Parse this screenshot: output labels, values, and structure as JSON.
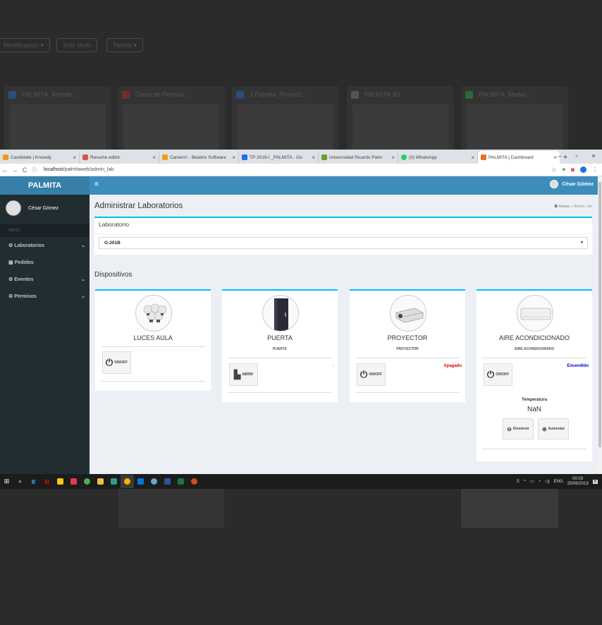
{
  "background": {
    "buttons": [
      "Modificación ▾",
      "Solo título",
      "Tareas ▾"
    ],
    "cards": [
      "PALMITA_Arquite...",
      "Clase de Permisi...",
      "3.Palmita_Proyect...",
      "PALMITA 3D",
      "PALMITA_Model..."
    ]
  },
  "browser": {
    "tabs": [
      {
        "title": "Candidate | Knowdy",
        "color": "#f09a1a"
      },
      {
        "title": "Resume editor",
        "color": "#d9534f"
      },
      {
        "title": "Careers! - Belatrix Software",
        "color": "#f0a010"
      },
      {
        "title": "TP 2019-I _PALMITA - Go",
        "color": "#1a73e8"
      },
      {
        "title": "Universidad Ricardo Palm",
        "color": "#6a9e2a"
      },
      {
        "title": "(3) WhatsApp",
        "color": "#25d366"
      },
      {
        "title": "PALMITA | Dashboard",
        "color": "#e8711a"
      }
    ],
    "url_host": "localhost",
    "url_path": "/palmitaweb/admin_lab"
  },
  "app": {
    "logo": "PALMITA",
    "header_user": "César Gómez",
    "sidebar": {
      "user": "César Gómez",
      "menu_header": "MENÚ",
      "items": [
        "Laboratorios",
        "Pedidos",
        "Eventos",
        "Permisos"
      ]
    },
    "page_title": "Administrar Laboratorios",
    "breadcrumb": {
      "home": "Home",
      "current": "Admin. lab"
    },
    "lab_box": {
      "label": "Laboratorio",
      "selected": "G-201B"
    },
    "devices_title": "Dispositivos",
    "devices": [
      {
        "name": "LUCES AULA",
        "subtitle": "",
        "button": "ON/OFF",
        "status": "",
        "status_color": ""
      },
      {
        "name": "PUERTA",
        "subtitle": "PUERTA",
        "button": "ABRIR",
        "status": "-",
        "status_color": "#999999"
      },
      {
        "name": "PROYECTOR",
        "subtitle": "PROYECTOR",
        "button": "ON/OFF",
        "status": "Apagado",
        "status_color": "#dd0000"
      },
      {
        "name": "AIRE ACONDICIONADO",
        "subtitle": "AIRE ACONDICIONADO",
        "button": "ON/OFF",
        "status": "Encendido",
        "status_color": "#0000cc"
      }
    ],
    "temperature": {
      "label": "Temperatura",
      "value": "NaN",
      "decrease": "Disminuir",
      "increase": "Aumentar"
    }
  },
  "taskbar": {
    "time": "00:03",
    "date": "25/06/2019",
    "lang": "ENG",
    "notifications": "6"
  }
}
